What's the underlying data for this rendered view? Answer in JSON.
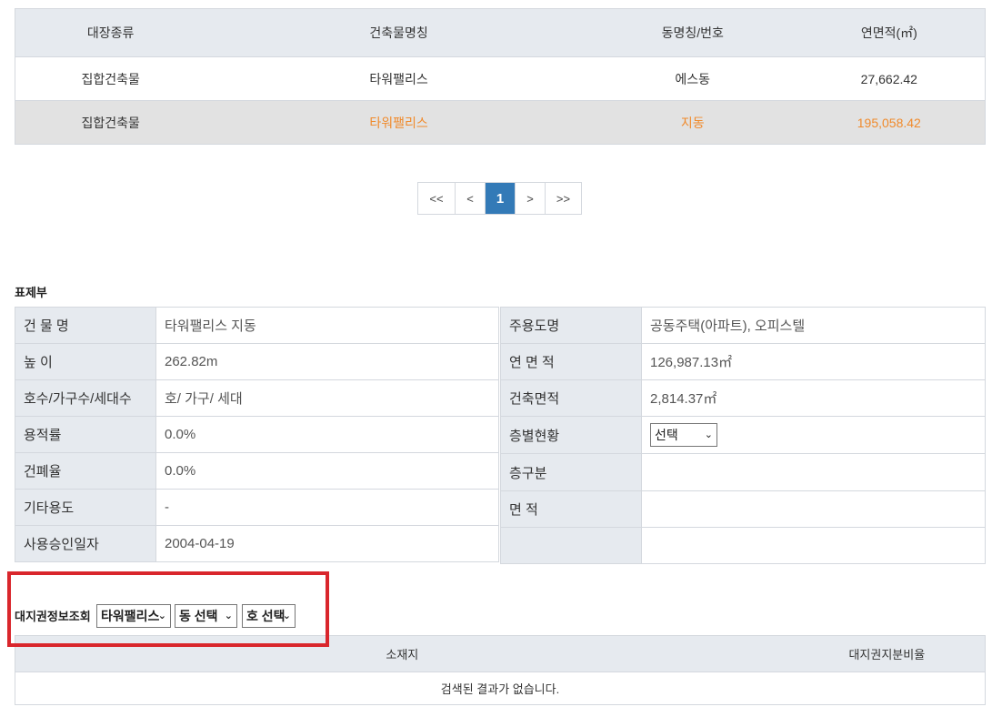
{
  "top_table": {
    "headers": [
      "대장종류",
      "건축물명칭",
      "동명칭/번호",
      "연면적(㎡)"
    ],
    "rows": [
      {
        "type": "집합건축물",
        "name": "타워팰리스",
        "dong": "에스동",
        "area": "27,662.42"
      },
      {
        "type": "집합건축물",
        "name": "타워팰리스",
        "dong": "지동",
        "area": "195,058.42"
      }
    ]
  },
  "pagination": {
    "first": "<<",
    "prev": "<",
    "current": "1",
    "next": ">",
    "last": ">>"
  },
  "section_title": "표제부",
  "info_left": [
    {
      "label": "건 물 명",
      "value": "타워팰리스 지동"
    },
    {
      "label": "높 이",
      "value": "262.82m"
    },
    {
      "label": "호수/가구수/세대수",
      "value": "호/ 가구/ 세대"
    },
    {
      "label": "용적률",
      "value": "0.0%"
    },
    {
      "label": "건폐율",
      "value": "0.0%"
    },
    {
      "label": "기타용도",
      "value": "-"
    },
    {
      "label": "사용승인일자",
      "value": "2004-04-19"
    }
  ],
  "info_right": [
    {
      "label": "주용도명",
      "value": "공동주택(아파트), 오피스텔"
    },
    {
      "label": "연 면 적",
      "value": "126,987.13㎡"
    },
    {
      "label": "건축면적",
      "value": "2,814.37㎡"
    },
    {
      "label": "층별현황",
      "select": "선택"
    },
    {
      "label": "층구분",
      "value": ""
    },
    {
      "label": "면 적",
      "value": ""
    },
    {
      "label": "",
      "value": ""
    }
  ],
  "site_lookup": {
    "label": "대지권정보조회",
    "building_select": "타워팰리스",
    "dong_select": "동 선택",
    "ho_select": "호 선택"
  },
  "bottom_table": {
    "headers": [
      "소재지",
      "대지권지분비율"
    ],
    "empty_message": "검색된 결과가 없습니다."
  },
  "colors": {
    "highlight": "#f08a2b",
    "page_active": "#337ab7",
    "annotation_box": "#d9262c",
    "header_bg": "#e6eaef"
  },
  "icons": {
    "select_arrow": "chevron-down-icon"
  }
}
